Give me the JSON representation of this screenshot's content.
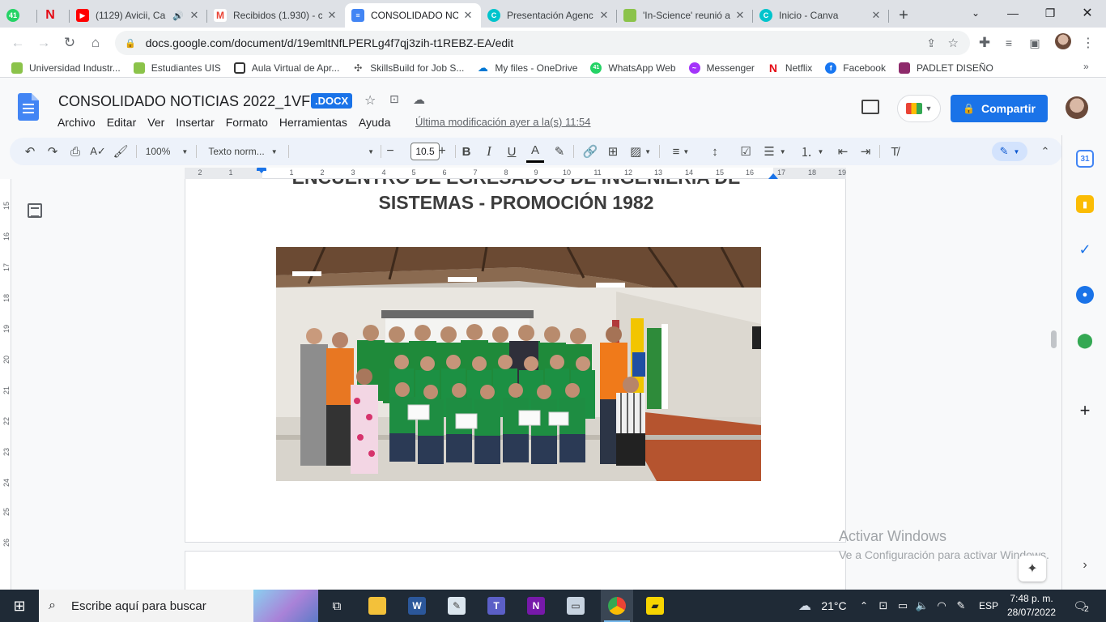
{
  "browser": {
    "tabs": [
      {
        "title": "",
        "favicon": "whatsapp-icon",
        "color": "#25d366",
        "badge": "41"
      },
      {
        "title": "",
        "favicon": "netflix-icon",
        "color": "#e50914"
      },
      {
        "title": "(1129) Avicii, Ca",
        "favicon": "youtube-icon",
        "color": "#ff0000"
      },
      {
        "title": "Recibidos (1.930) - c",
        "favicon": "gmail-icon",
        "color": "#ea4335"
      },
      {
        "title": "CONSOLIDADO NC",
        "favicon": "docs-icon",
        "color": "#4285f4"
      },
      {
        "title": "Presentación Agenc",
        "favicon": "canva-icon",
        "color": "#00c4cc"
      },
      {
        "title": "'In-Science' reunió a",
        "favicon": "uis-icon",
        "color": "#8bc34a"
      },
      {
        "title": "Inicio - Canva",
        "favicon": "canva-icon",
        "color": "#00c4cc"
      }
    ],
    "new_tab": "+",
    "url": "docs.google.com/document/d/19emltNfLPERLg4f7qj3zih-t1REBZ-EA/edit",
    "bookmarks": [
      {
        "label": "Universidad Industr...",
        "icon": "uis-icon",
        "color": "#8bc34a"
      },
      {
        "label": "Estudiantes UIS",
        "icon": "uis-icon",
        "color": "#8bc34a"
      },
      {
        "label": "Aula Virtual de Apr...",
        "icon": "aula-icon",
        "color": "#333333"
      },
      {
        "label": "SkillsBuild for Job S...",
        "icon": "skillsbuild-icon",
        "color": "#555555"
      },
      {
        "label": "My files - OneDrive",
        "icon": "onedrive-icon",
        "color": "#0078d4"
      },
      {
        "label": "WhatsApp Web",
        "icon": "whatsapp-icon",
        "color": "#25d366",
        "badge": "41"
      },
      {
        "label": "Messenger",
        "icon": "messenger-icon",
        "color": "#a334fa"
      },
      {
        "label": "Netflix",
        "icon": "netflix-icon",
        "color": "#e50914"
      },
      {
        "label": "Facebook",
        "icon": "facebook-icon",
        "color": "#1877f2"
      },
      {
        "label": "PADLET DISEÑO",
        "icon": "padlet-icon",
        "color": "#8e2a6b"
      }
    ]
  },
  "docs": {
    "title": "CONSOLIDADO NOTICIAS 2022_1VF",
    "badge": ".DOCX",
    "menu": [
      "Archivo",
      "Editar",
      "Ver",
      "Insertar",
      "Formato",
      "Herramientas",
      "Ayuda"
    ],
    "last_modified": "Última modificación ayer a la(s) 11:54",
    "share_label": "Compartir",
    "toolbar": {
      "zoom": "100%",
      "style": "Texto norm...",
      "font": "",
      "font_size": "10.5",
      "bold": "B",
      "italic": "I",
      "underline": "U",
      "text_color": "A"
    },
    "ruler_numbers": [
      "2",
      "1",
      "1",
      "2",
      "3",
      "4",
      "5",
      "6",
      "7",
      "8",
      "9",
      "10",
      "11",
      "12",
      "13",
      "14",
      "15",
      "16",
      "17",
      "18",
      "19"
    ],
    "vruler_numbers": [
      "15",
      "16",
      "17",
      "18",
      "19",
      "20",
      "21",
      "22",
      "23",
      "24",
      "25",
      "26"
    ],
    "content": {
      "heading_line1": "ENCUENTRO DE EGRESADOS DE INGENIERÍA DE",
      "heading_line2": "SISTEMAS - PROMOCIÓN 1982",
      "photo_description": "group-photo"
    }
  },
  "watermark": {
    "line1": "Activar Windows",
    "line2": "Ve a Configuración para activar Windows."
  },
  "taskbar": {
    "search_placeholder": "Escribe aquí para buscar",
    "temperature": "21°C",
    "language": "ESP",
    "time": "7:48 p. m.",
    "date": "28/07/2022",
    "notification_count": "2"
  }
}
